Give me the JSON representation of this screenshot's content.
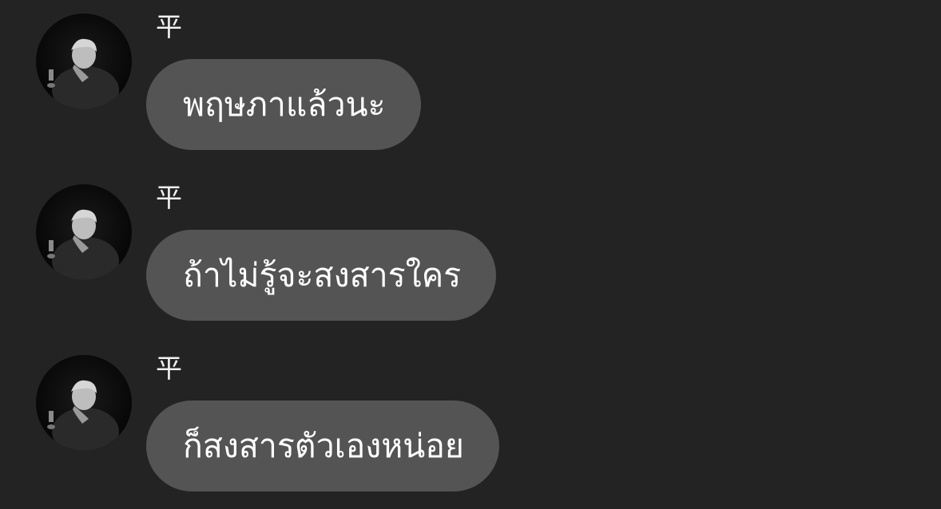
{
  "messages": [
    {
      "sender": "平",
      "text": "พฤษภาแล้วนะ",
      "avatar_icon": "user-avatar-icon"
    },
    {
      "sender": "平",
      "text": "ถ้าไม่รู้จะสงสารใคร",
      "avatar_icon": "user-avatar-icon"
    },
    {
      "sender": "平",
      "text": "ก็สงสารตัวเองหน่อย",
      "avatar_icon": "user-avatar-icon"
    }
  ],
  "colors": {
    "background": "#232323",
    "bubble": "#545454",
    "text": "#ffffff"
  }
}
